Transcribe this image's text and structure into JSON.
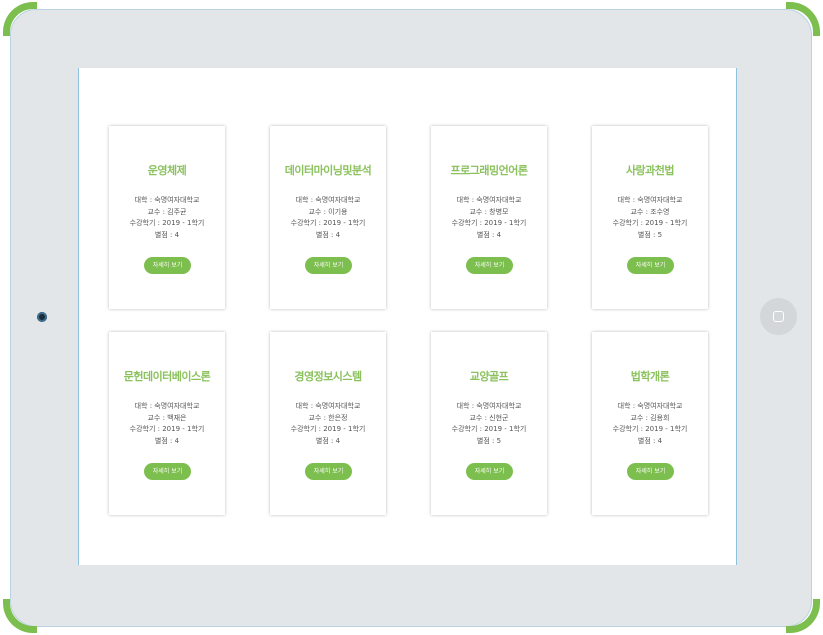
{
  "courses": [
    {
      "title": "운영체제",
      "university": "대학 : 숙명여자대학교",
      "professor": "교수 : 김주균",
      "semester": "수강학기 : 2019 - 1학기",
      "rating": "별점 : 4",
      "button_label": "자세히 보기"
    },
    {
      "title": "데이터마이닝및분석",
      "university": "대학 : 숙명여자대학교",
      "professor": "교수 : 이기용",
      "semester": "수강학기 : 2019 - 1학기",
      "rating": "별점 : 4",
      "button_label": "자세히 보기"
    },
    {
      "title": "프로그래밍언어론",
      "university": "대학 : 숙명여자대학교",
      "professor": "교수 : 창병모",
      "semester": "수강학기 : 2019 - 1학기",
      "rating": "별점 : 4",
      "button_label": "자세히 보기"
    },
    {
      "title": "사랑과천법",
      "university": "대학 : 숙명여자대학교",
      "professor": "교수 : 조수영",
      "semester": "수강학기 : 2019 - 1학기",
      "rating": "별점 : 5",
      "button_label": "자세히 보기"
    },
    {
      "title": "문헌데이터베이스론",
      "university": "대학 : 숙명여자대학교",
      "professor": "교수 : 백재은",
      "semester": "수강학기 : 2019 - 1학기",
      "rating": "별점 : 4",
      "button_label": "자세히 보기"
    },
    {
      "title": "경영정보시스템",
      "university": "대학 : 숙명여자대학교",
      "professor": "교수 : 한은정",
      "semester": "수강학기 : 2019 - 1학기",
      "rating": "별점 : 4",
      "button_label": "자세히 보기"
    },
    {
      "title": "교양골프",
      "university": "대학 : 숙명여자대학교",
      "professor": "교수 : 신현군",
      "semester": "수강학기 : 2019 - 1학기",
      "rating": "별점 : 5",
      "button_label": "자세히 보기"
    },
    {
      "title": "법학개론",
      "university": "대학 : 숙명여자대학교",
      "professor": "교수 : 김용희",
      "semester": "수강학기 : 2019 - 1학기",
      "rating": "별점 : 4",
      "button_label": "자세히 보기"
    }
  ],
  "colors": {
    "accent": "#7dbf4f",
    "title": "#8bc25e",
    "frame": "#e3e6e8"
  },
  "icons": {
    "camera": "camera-icon",
    "home": "home-button-icon"
  }
}
